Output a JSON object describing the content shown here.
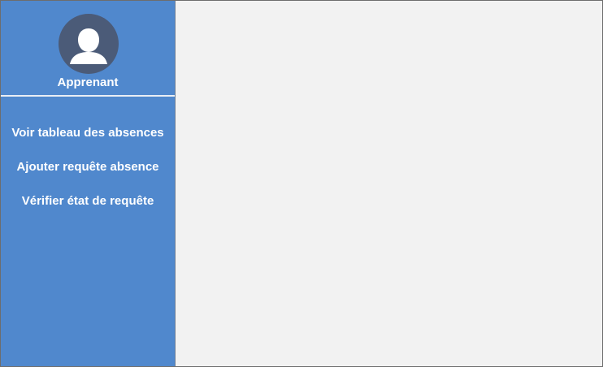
{
  "sidebar": {
    "profile": {
      "name": "Apprenant",
      "avatar_icon": "user-avatar-icon"
    },
    "menu_items": [
      {
        "label": "Voir tableau des absences"
      },
      {
        "label": "Ajouter requête absence"
      },
      {
        "label": "Vérifier état de requête"
      }
    ]
  },
  "colors": {
    "sidebar_bg": "#5088cd",
    "content_bg": "#f2f2f2",
    "avatar_bg": "#4b5b78",
    "text": "#ffffff"
  }
}
